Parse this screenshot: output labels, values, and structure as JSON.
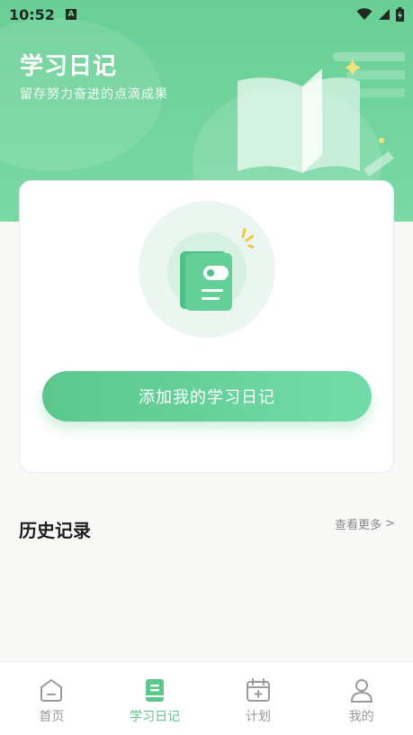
{
  "status_bar": {
    "time": "10:52",
    "badge": "A"
  },
  "header": {
    "title": "学习日记",
    "subtitle": "留存努力奋进的点滴成果"
  },
  "card": {
    "add_button_label": "添加我的学习日记"
  },
  "history": {
    "title": "历史记录",
    "more_label": "查看更多",
    "more_chevron": ">"
  },
  "tabbar": {
    "items": [
      {
        "label": "首页",
        "icon": "home-icon",
        "active": false
      },
      {
        "label": "学习日记",
        "icon": "diary-icon",
        "active": true
      },
      {
        "label": "计划",
        "icon": "calendar-plus-icon",
        "active": false
      },
      {
        "label": "我的",
        "icon": "person-icon",
        "active": false
      }
    ]
  },
  "colors": {
    "brand_green": "#5bc78d",
    "header_green": "#69cf95",
    "inactive_gray": "#9a9a9a"
  }
}
